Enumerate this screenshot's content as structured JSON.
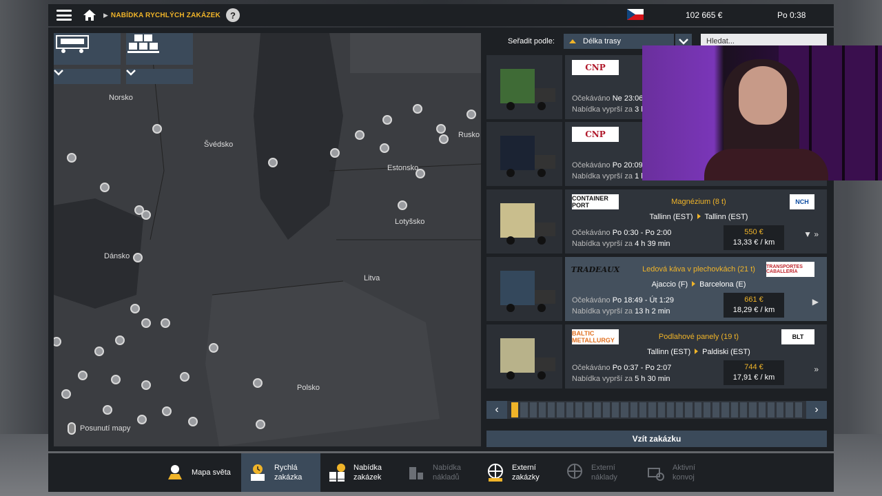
{
  "header": {
    "breadcrumb": "NABÍDKA RYCHLÝCH ZAKÁZEK",
    "help": "?",
    "money": "102 665 €",
    "time": "Po 0:38"
  },
  "map": {
    "labels": {
      "norsko": "Norsko",
      "svedsko": "Švédsko",
      "rusko": "Rusko",
      "estonsko": "Estonsko",
      "lotyssko": "Lotyšsko",
      "dansko": "Dánsko",
      "litva": "Litva",
      "polsko": "Polsko"
    },
    "pan_hint": "Posunutí mapy"
  },
  "list": {
    "sort_label": "Seřadit podle:",
    "sort_value": "Délka trasy",
    "search_placeholder": "Hledat...",
    "rows": [
      {
        "logo": "CNP",
        "logo2": "",
        "cargo": "",
        "from": "",
        "to": "",
        "exp_label": "Očekáváno",
        "exp_value": "Ne 23:06",
        "offer_label": "Nabídka vyprší za",
        "offer_value": "3 h",
        "price": "",
        "per_km": ""
      },
      {
        "logo": "CNP",
        "logo2": "",
        "cargo": "",
        "from": "",
        "to": "",
        "exp_label": "Očekáváno",
        "exp_value": "Po 20:09",
        "offer_label": "Nabídka vyprší za",
        "offer_value": "1 h",
        "price": "",
        "per_km": ""
      },
      {
        "logo": "CONTAINER PORT",
        "logo2": "NCH",
        "cargo": "Magnézium (8 t)",
        "from": "Tallinn (EST)",
        "to": "Tallinn (EST)",
        "exp_label": "Očekáváno",
        "exp_value": "Po 0:30 - Po 2:00",
        "offer_label": "Nabídka vyprší za",
        "offer_value": "4 h 39 min",
        "price": "550 €",
        "per_km": "13,33 € / km"
      },
      {
        "logo": "TRADEAUX",
        "logo2": "TRANSPORTES CABALLERÍA",
        "cargo": "Ledová káva v plechovkách (21 t)",
        "from": "Ajaccio (F)",
        "to": "Barcelona (E)",
        "exp_label": "Očekáváno",
        "exp_value": "Po 18:49 - Út 1:29",
        "offer_label": "Nabídka vyprší za",
        "offer_value": "13 h 2 min",
        "price": "661 €",
        "per_km": "18,29 € / km"
      },
      {
        "logo": "BALTIC METALLURGY",
        "logo2": "BLT",
        "cargo": "Podlahové panely (19 t)",
        "from": "Tallinn (EST)",
        "to": "Paldiski (EST)",
        "exp_label": "Očekáváno",
        "exp_value": "Po 0:37 - Po 2:07",
        "offer_label": "Nabídka vyprší za",
        "offer_value": "5 h 30 min",
        "price": "744 €",
        "per_km": "17,91 € / km"
      }
    ],
    "take_button": "Vzít zakázku"
  },
  "tabs": [
    {
      "label1": "Mapa světa",
      "label2": "",
      "icon": "map-pin-icon"
    },
    {
      "label1": "Rychlá",
      "label2": "zakázka",
      "icon": "clock-icon"
    },
    {
      "label1": "Nabídka",
      "label2": "zakázek",
      "icon": "cargo-icon"
    },
    {
      "label1": "Nabídka",
      "label2": "nákladů",
      "icon": "freight-icon"
    },
    {
      "label1": "Externí",
      "label2": "zakázky",
      "icon": "globe-icon"
    },
    {
      "label1": "Externí",
      "label2": "náklady",
      "icon": "globe-freight-icon"
    },
    {
      "label1": "Aktivní",
      "label2": "konvoj",
      "icon": "convoy-icon"
    }
  ]
}
